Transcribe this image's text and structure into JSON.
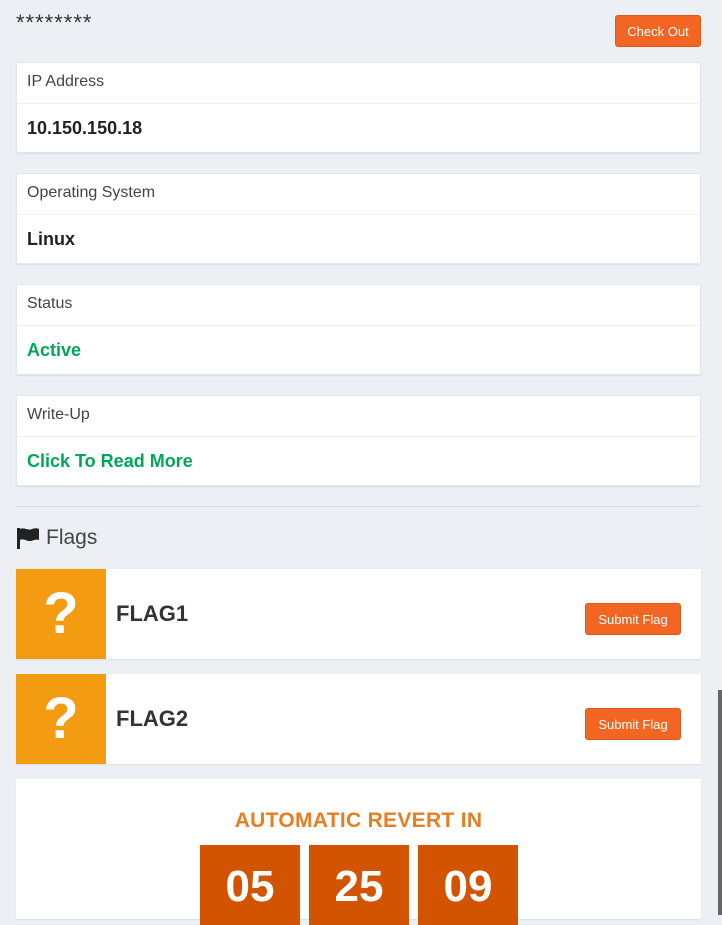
{
  "header": {
    "masked_name": "********",
    "checkout_label": "Check Out"
  },
  "info": [
    {
      "label": "IP Address",
      "value": "10.150.150.18"
    },
    {
      "label": "Operating System",
      "value": "Linux"
    },
    {
      "label": "Status",
      "value": "Active"
    },
    {
      "label": "Write-Up",
      "value": "Click To Read More"
    }
  ],
  "flags": {
    "title": "Flags",
    "icon": "flag-icon",
    "items": [
      {
        "icon_glyph": "?",
        "name": "FLAG1",
        "button": "Submit Flag"
      },
      {
        "icon_glyph": "?",
        "name": "FLAG2",
        "button": "Submit Flag"
      }
    ]
  },
  "revert": {
    "title": "AUTOMATIC REVERT IN",
    "hours": "05",
    "minutes": "25",
    "seconds": "09"
  },
  "colors": {
    "accent_orange": "#f26522",
    "flag_tile": "#f39c12",
    "countdown": "#d35400",
    "status_green": "#00a65a"
  }
}
